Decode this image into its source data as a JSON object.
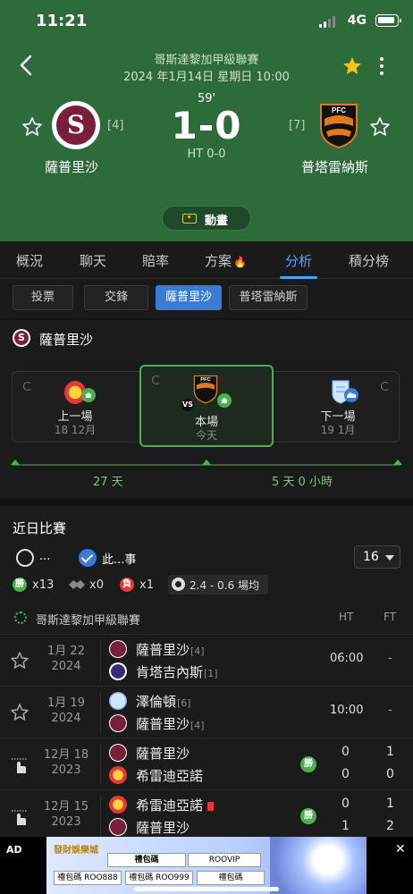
{
  "status": {
    "time": "11:21",
    "network": "4G"
  },
  "match": {
    "league": "哥斯達黎加甲級聯賽",
    "datetime": "2024 年1月14日 星期日 10:00",
    "minute": "59'",
    "score": "1-0",
    "halftime": "HT 0-0",
    "home": {
      "name": "薩普里沙",
      "rank": "[4]",
      "logo_letter": "S"
    },
    "away": {
      "name": "普塔雷納斯",
      "rank": "[7]"
    },
    "animation_label": "動畫"
  },
  "tabs": [
    "概況",
    "聊天",
    "賠率",
    "方案",
    "分析",
    "積分榜"
  ],
  "active_tab": "分析",
  "subtabs": [
    "投票",
    "交鋒",
    "薩普里沙",
    "普塔雷納斯"
  ],
  "active_subtab": "薩普里沙",
  "team_section": {
    "title": "薩普里沙",
    "prev": {
      "label": "上一場",
      "date": "18 12月"
    },
    "current": {
      "label": "本場",
      "date": "今天"
    },
    "next": {
      "label": "下一場",
      "date": "19 1月"
    },
    "gap_before": "27 天",
    "gap_after": "5 天 0 小時"
  },
  "recent": {
    "title": "近日比賽",
    "option_all": "...",
    "option_this": "此...事",
    "count": "16",
    "wins": "x13",
    "draws": "x0",
    "losses": "x1",
    "win_label": "勝",
    "loss_label": "負",
    "average": "2.4 - 0.6 場均",
    "league_name": "哥斯達黎加甲級聯賽",
    "col_ht": "HT",
    "col_ft": "FT",
    "matches": [
      {
        "date": "1月 22",
        "year": "2024",
        "home": "薩普里沙",
        "home_rank": "[4]",
        "away": "肯塔吉內斯",
        "away_rank": "[1]",
        "time": "06:00",
        "ft": "-"
      },
      {
        "date": "1月 19",
        "year": "2024",
        "home": "澤倫頓",
        "home_rank": "[6]",
        "away": "薩普里沙",
        "away_rank": "[4]",
        "time": "10:00",
        "ft": "-"
      },
      {
        "date": "12月 18",
        "year": "2023",
        "home": "薩普里沙",
        "away": "希雷迪亞諾",
        "ht_home": "0",
        "ht_away": "0",
        "ft_home": "1",
        "ft_away": "0",
        "result": "勝"
      },
      {
        "date": "12月 15",
        "year": "2023",
        "home": "希雷迪亞諾",
        "away": "薩普里沙",
        "ht_home": "0",
        "ht_away": "1",
        "ft_home": "1",
        "ft_away": "2",
        "result": "勝"
      }
    ]
  },
  "ad": {
    "tag": "AD",
    "close": "✕",
    "brand": "發財娛樂城",
    "btn1": "禮包碼",
    "btn2": "ROOVIP",
    "btn3": "禮包碼 ROO888",
    "btn4": "禮包碼 ROO999",
    "btn5": "禮包碼"
  },
  "colors": {
    "header": "#2e6b3a",
    "accent": "#4da3ff",
    "win": "#4caf50",
    "loss": "#e53935"
  }
}
